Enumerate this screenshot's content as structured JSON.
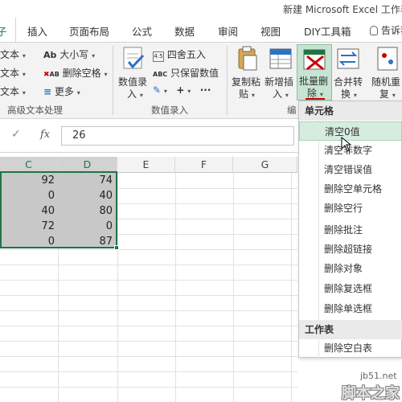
{
  "window": {
    "title": "新建 Microsoft Excel 工作表"
  },
  "tabs": [
    {
      "label": "插入"
    },
    {
      "label": "页面布局"
    },
    {
      "label": "公式"
    },
    {
      "label": "数据"
    },
    {
      "label": "审阅"
    },
    {
      "label": "视图"
    },
    {
      "label": "DIY工具箱"
    }
  ],
  "active_tab_fragment": "子",
  "tell_me": "告诉我",
  "ribbon": {
    "text_group": {
      "items": [
        "文本",
        "文本",
        "文本"
      ],
      "label": "高级文本处理",
      "case_label": "大小写",
      "case_icon_text": "Ab",
      "delete_space_label": "删除空格",
      "delete_space_icon_text": "AB",
      "more_label": "更多"
    },
    "entry_group": {
      "value_entry_label": [
        "数值录",
        "入"
      ],
      "round_label": "四舍五入",
      "keep_value_label": "只保留数值",
      "keep_value_icon_text": "ABC",
      "label": "数值录入"
    },
    "edit_group": {
      "copy_paste_label": [
        "复制粘",
        "贴"
      ],
      "new_insert_label": [
        "新增插",
        "入"
      ],
      "batch_delete_label": [
        "批量删",
        "除"
      ],
      "merge_convert_label": [
        "合并转",
        "换"
      ],
      "random_repeat_label": [
        "随机重",
        "复"
      ],
      "label_fragment": "编"
    }
  },
  "formula_bar": {
    "value": "26",
    "fx": "fx"
  },
  "grid": {
    "columns": [
      "C",
      "D",
      "E",
      "F",
      "G"
    ],
    "selected_columns": [
      "C",
      "D"
    ],
    "rows": [
      {
        "c": "92",
        "d": "74"
      },
      {
        "c": "0",
        "d": "40"
      },
      {
        "c": "40",
        "d": "80"
      },
      {
        "c": "72",
        "d": "0"
      },
      {
        "c": "0",
        "d": "87"
      }
    ]
  },
  "menu": {
    "section_cells": "单元格",
    "cell_items": [
      "清空0值",
      "清空非数字",
      "清空错误值",
      "删除空单元格",
      "删除空行",
      "删除批注",
      "删除超链接",
      "删除对象",
      "删除复选框",
      "删除单选框"
    ],
    "hover_item": "清空0值",
    "section_sheet": "工作表",
    "sheet_items": [
      "删除空白表"
    ]
  },
  "watermark": {
    "url": "jb51.net",
    "brand": "脚本之家"
  },
  "colors": {
    "accent": "#217346",
    "hover": "#d6ecdf",
    "ribbon_bg": "#f3f3f3",
    "selection": "#c8c8c8"
  }
}
